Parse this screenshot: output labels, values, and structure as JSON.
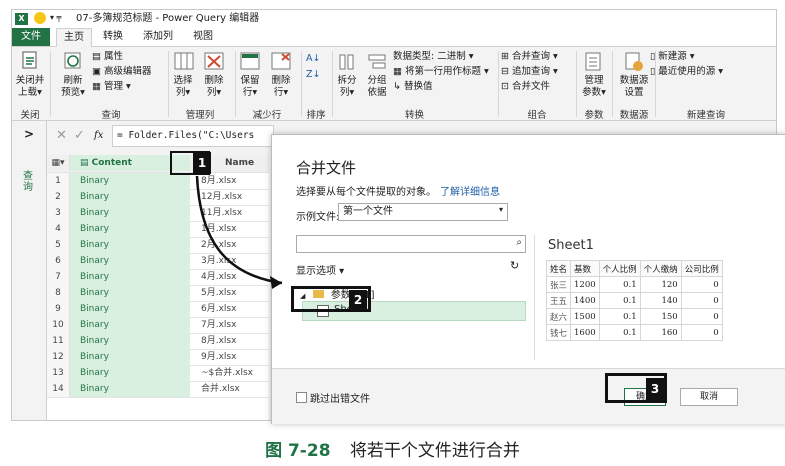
{
  "window": {
    "title": "07-多簿规范标题 - Power Query 编辑器",
    "app_badge": "X",
    "tabs": [
      {
        "label": "文件"
      },
      {
        "label": "主页"
      },
      {
        "label": "转换"
      },
      {
        "label": "添加列"
      },
      {
        "label": "视图"
      }
    ]
  },
  "ribbon": {
    "close": {
      "btn1": "关闭并",
      "btn1b": "上载",
      "group": "关闭"
    },
    "query": {
      "refresh": "刷新",
      "refresh_b": "预览",
      "props": "属性",
      "adv": "高级编辑器",
      "manage": "管理",
      "group": "查询"
    },
    "cols": {
      "choose": "选择",
      "choose_b": "列",
      "remove": "删除",
      "remove_b": "列",
      "group": "管理列"
    },
    "rows": {
      "keep": "保留",
      "keep_b": "行",
      "del": "删除",
      "del_b": "行",
      "group": "减少行"
    },
    "sort": {
      "group": "排序"
    },
    "transform": {
      "split": "拆分",
      "split_b": "列",
      "groupby": "分组",
      "groupby_b": "依据",
      "dtype": "数据类型: 二进制",
      "firstrow": "将第一行用作标题",
      "replace": "替换值",
      "group": "转换"
    },
    "combine": {
      "merge": "合并查询",
      "append": "追加查询",
      "mergefiles": "合并文件",
      "group": "组合"
    },
    "params": {
      "manage": "管理",
      "manage_b": "参数",
      "group": "参数"
    },
    "datasource": {
      "settings": "数据源",
      "settings_b": "设置",
      "group": "数据源"
    },
    "newquery": {
      "newsrc": "新建源",
      "recent": "最近使用的源",
      "group": "新建查询"
    }
  },
  "leftnav": {
    "label": "查询",
    "chevron": ">"
  },
  "formula": {
    "fx": "fx",
    "text": "= Folder.Files(\"C:\\Users"
  },
  "grid": {
    "col_content": "Content",
    "col_name": "Name",
    "rows": [
      {
        "n": "1",
        "c": "Binary",
        "name": "8月.xlsx"
      },
      {
        "n": "2",
        "c": "Binary",
        "name": "12月.xlsx"
      },
      {
        "n": "3",
        "c": "Binary",
        "name": "11月.xlsx"
      },
      {
        "n": "4",
        "c": "Binary",
        "name": "1月.xlsx"
      },
      {
        "n": "5",
        "c": "Binary",
        "name": "2月.xlsx"
      },
      {
        "n": "6",
        "c": "Binary",
        "name": "3月.xlsx"
      },
      {
        "n": "7",
        "c": "Binary",
        "name": "4月.xlsx"
      },
      {
        "n": "8",
        "c": "Binary",
        "name": "5月.xlsx"
      },
      {
        "n": "9",
        "c": "Binary",
        "name": "6月.xlsx"
      },
      {
        "n": "10",
        "c": "Binary",
        "name": "7月.xlsx"
      },
      {
        "n": "11",
        "c": "Binary",
        "name": "8月.xlsx"
      },
      {
        "n": "12",
        "c": "Binary",
        "name": "9月.xlsx"
      },
      {
        "n": "13",
        "c": "Binary",
        "name": "~$合并.xlsx"
      },
      {
        "n": "14",
        "c": "Binary",
        "name": "合并.xlsx"
      }
    ]
  },
  "dialog": {
    "title": "合并文件",
    "desc": "选择要从每个文件提取的对象。",
    "learn": "了解详细信息",
    "sample_label": "示例文件:",
    "sample_value": "第一个文件",
    "show_options": "显示选项",
    "tree_folder": "参数1 [1]",
    "tree_sheet": "Sheet1",
    "preview_title": "Sheet1",
    "preview_headers": [
      "姓名",
      "基数",
      "个人比例",
      "个人缴纳",
      "公司比例"
    ],
    "preview_rows": [
      [
        "张三",
        "1200",
        "0.1",
        "120",
        "0"
      ],
      [
        "王五",
        "1400",
        "0.1",
        "140",
        "0"
      ],
      [
        "赵六",
        "1500",
        "0.1",
        "150",
        "0"
      ],
      [
        "钱七",
        "1600",
        "0.1",
        "160",
        "0"
      ]
    ],
    "skip_errors": "跳过出错文件",
    "ok": "确定",
    "cancel": "取消"
  },
  "callouts": {
    "one": "1",
    "two": "2",
    "three": "3"
  },
  "caption": {
    "fig": "图 7-28",
    "text": "将若干个文件进行合并"
  },
  "colors": {
    "accent": "#217346",
    "highlight": "#d9efe0",
    "callout": "#111111"
  }
}
